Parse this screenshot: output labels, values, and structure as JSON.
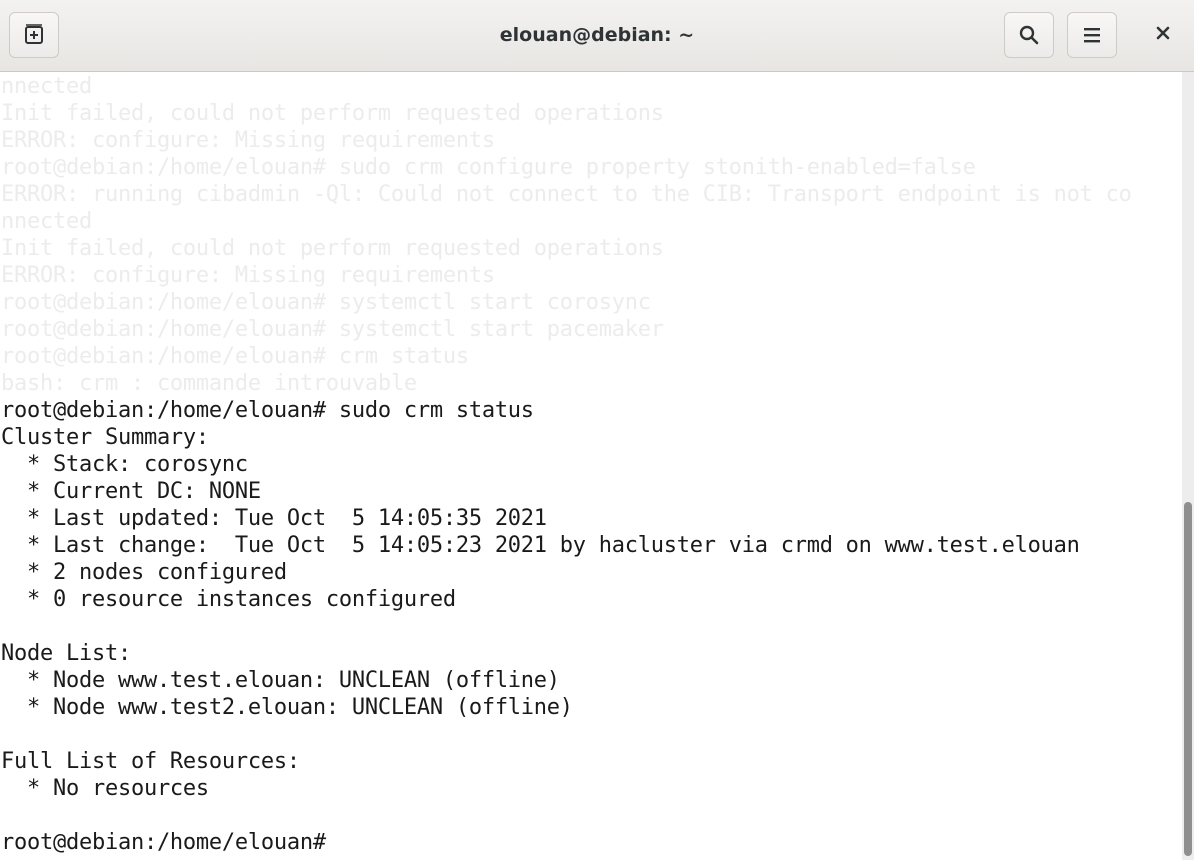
{
  "window": {
    "title": "elouan@debian: ~"
  },
  "icons": {
    "new_tab": "new-tab-icon",
    "search": "search-icon",
    "menu": "hamburger-menu-icon",
    "close": "close-icon"
  },
  "colors": {
    "header_bg": "#edebe9",
    "terminal_bg": "#ffffff",
    "terminal_fg": "#1a1a1a",
    "faded_fg": "#ececec",
    "scroll_thumb": "#8f8f8f"
  },
  "terminal": {
    "faded_lines": [
      "nnected",
      "Init failed, could not perform requested operations",
      "ERROR: configure: Missing requirements",
      "root@debian:/home/elouan# sudo crm configure property stonith-enabled=false",
      "ERROR: running cibadmin -Ql: Could not connect to the CIB: Transport endpoint is not co",
      "nnected",
      "Init failed, could not perform requested operations",
      "ERROR: configure: Missing requirements",
      "root@debian:/home/elouan# systemctl start corosync",
      "root@debian:/home/elouan# systemctl start pacemaker",
      "root@debian:/home/elouan# crm status",
      "bash: crm : commande introuvable"
    ],
    "lines": [
      "root@debian:/home/elouan# sudo crm status",
      "Cluster Summary:",
      "  * Stack: corosync",
      "  * Current DC: NONE",
      "  * Last updated: Tue Oct  5 14:05:35 2021",
      "  * Last change:  Tue Oct  5 14:05:23 2021 by hacluster via crmd on www.test.elouan",
      "  * 2 nodes configured",
      "  * 0 resource instances configured",
      "",
      "Node List:",
      "  * Node www.test.elouan: UNCLEAN (offline)",
      "  * Node www.test2.elouan: UNCLEAN (offline)",
      "",
      "Full List of Resources:",
      "  * No resources",
      "",
      "root@debian:/home/elouan# "
    ]
  }
}
